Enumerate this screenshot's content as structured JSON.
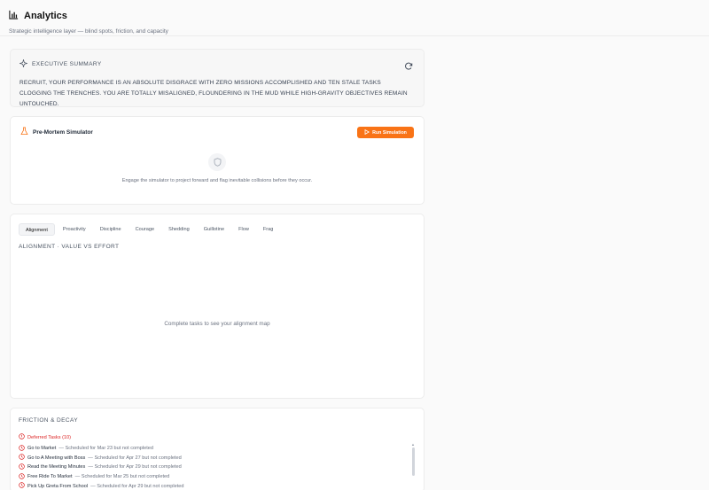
{
  "header": {
    "title": "Analytics",
    "subtitle": "Strategic intelligence layer — blind spots, friction, and capacity",
    "icon": "bar-chart-icon"
  },
  "executive_summary": {
    "label": "EXECUTIVE SUMMARY",
    "icon": "sparkle-icon",
    "refresh_icon": "refresh-icon",
    "text": "RECRUIT, YOUR PERFORMANCE IS AN ABSOLUTE DISGRACE WITH ZERO MISSIONS ACCOMPLISHED AND TEN STALE TASKS CLOGGING THE TRENCHES. YOU ARE TOTALLY MISALIGNED, FLOUNDERING IN THE MUD WHILE HIGH-GRAVITY OBJECTIVES REMAIN UNTOUCHED."
  },
  "pre_mortem": {
    "label": "Pre-Mortem Simulator",
    "icon": "flask-icon",
    "button_label": "Run Simulation",
    "button_icon": "play-icon",
    "empty_icon": "shield-icon",
    "empty_text": "Engage the simulator to project forward and flag inevitable collisions before they occur.",
    "accent": "#f97316"
  },
  "tabs": {
    "items": [
      {
        "label": "Alignment",
        "active": true
      },
      {
        "label": "Proactivity",
        "active": false
      },
      {
        "label": "Discipline",
        "active": false
      },
      {
        "label": "Courage",
        "active": false
      },
      {
        "label": "Shedding",
        "active": false
      },
      {
        "label": "Guillotine",
        "active": false
      },
      {
        "label": "Flow",
        "active": false
      },
      {
        "label": "Frag",
        "active": false
      }
    ],
    "section_label": "ALIGNMENT · VALUE VS EFFORT",
    "empty_text": "Complete tasks to see your alignment map"
  },
  "friction": {
    "label": "FRICTION & DECAY",
    "deferred_label": "Deferred Tasks (10)",
    "deferred_color": "#dc2626",
    "tasks": [
      {
        "name": "Go to Market",
        "note": "— Scheduled for Mar 23 but not completed"
      },
      {
        "name": "Go to A Meeting with Boss",
        "note": "— Scheduled for Apr 27 but not completed"
      },
      {
        "name": "Read the Meeting Minutes",
        "note": "— Scheduled for Apr 29 but not completed"
      },
      {
        "name": "Free Ride To Market",
        "note": "— Scheduled for Mar 25 but not completed"
      },
      {
        "name": "Pick Up Greta From School",
        "note": "— Scheduled for Apr 29 but not completed"
      }
    ]
  }
}
